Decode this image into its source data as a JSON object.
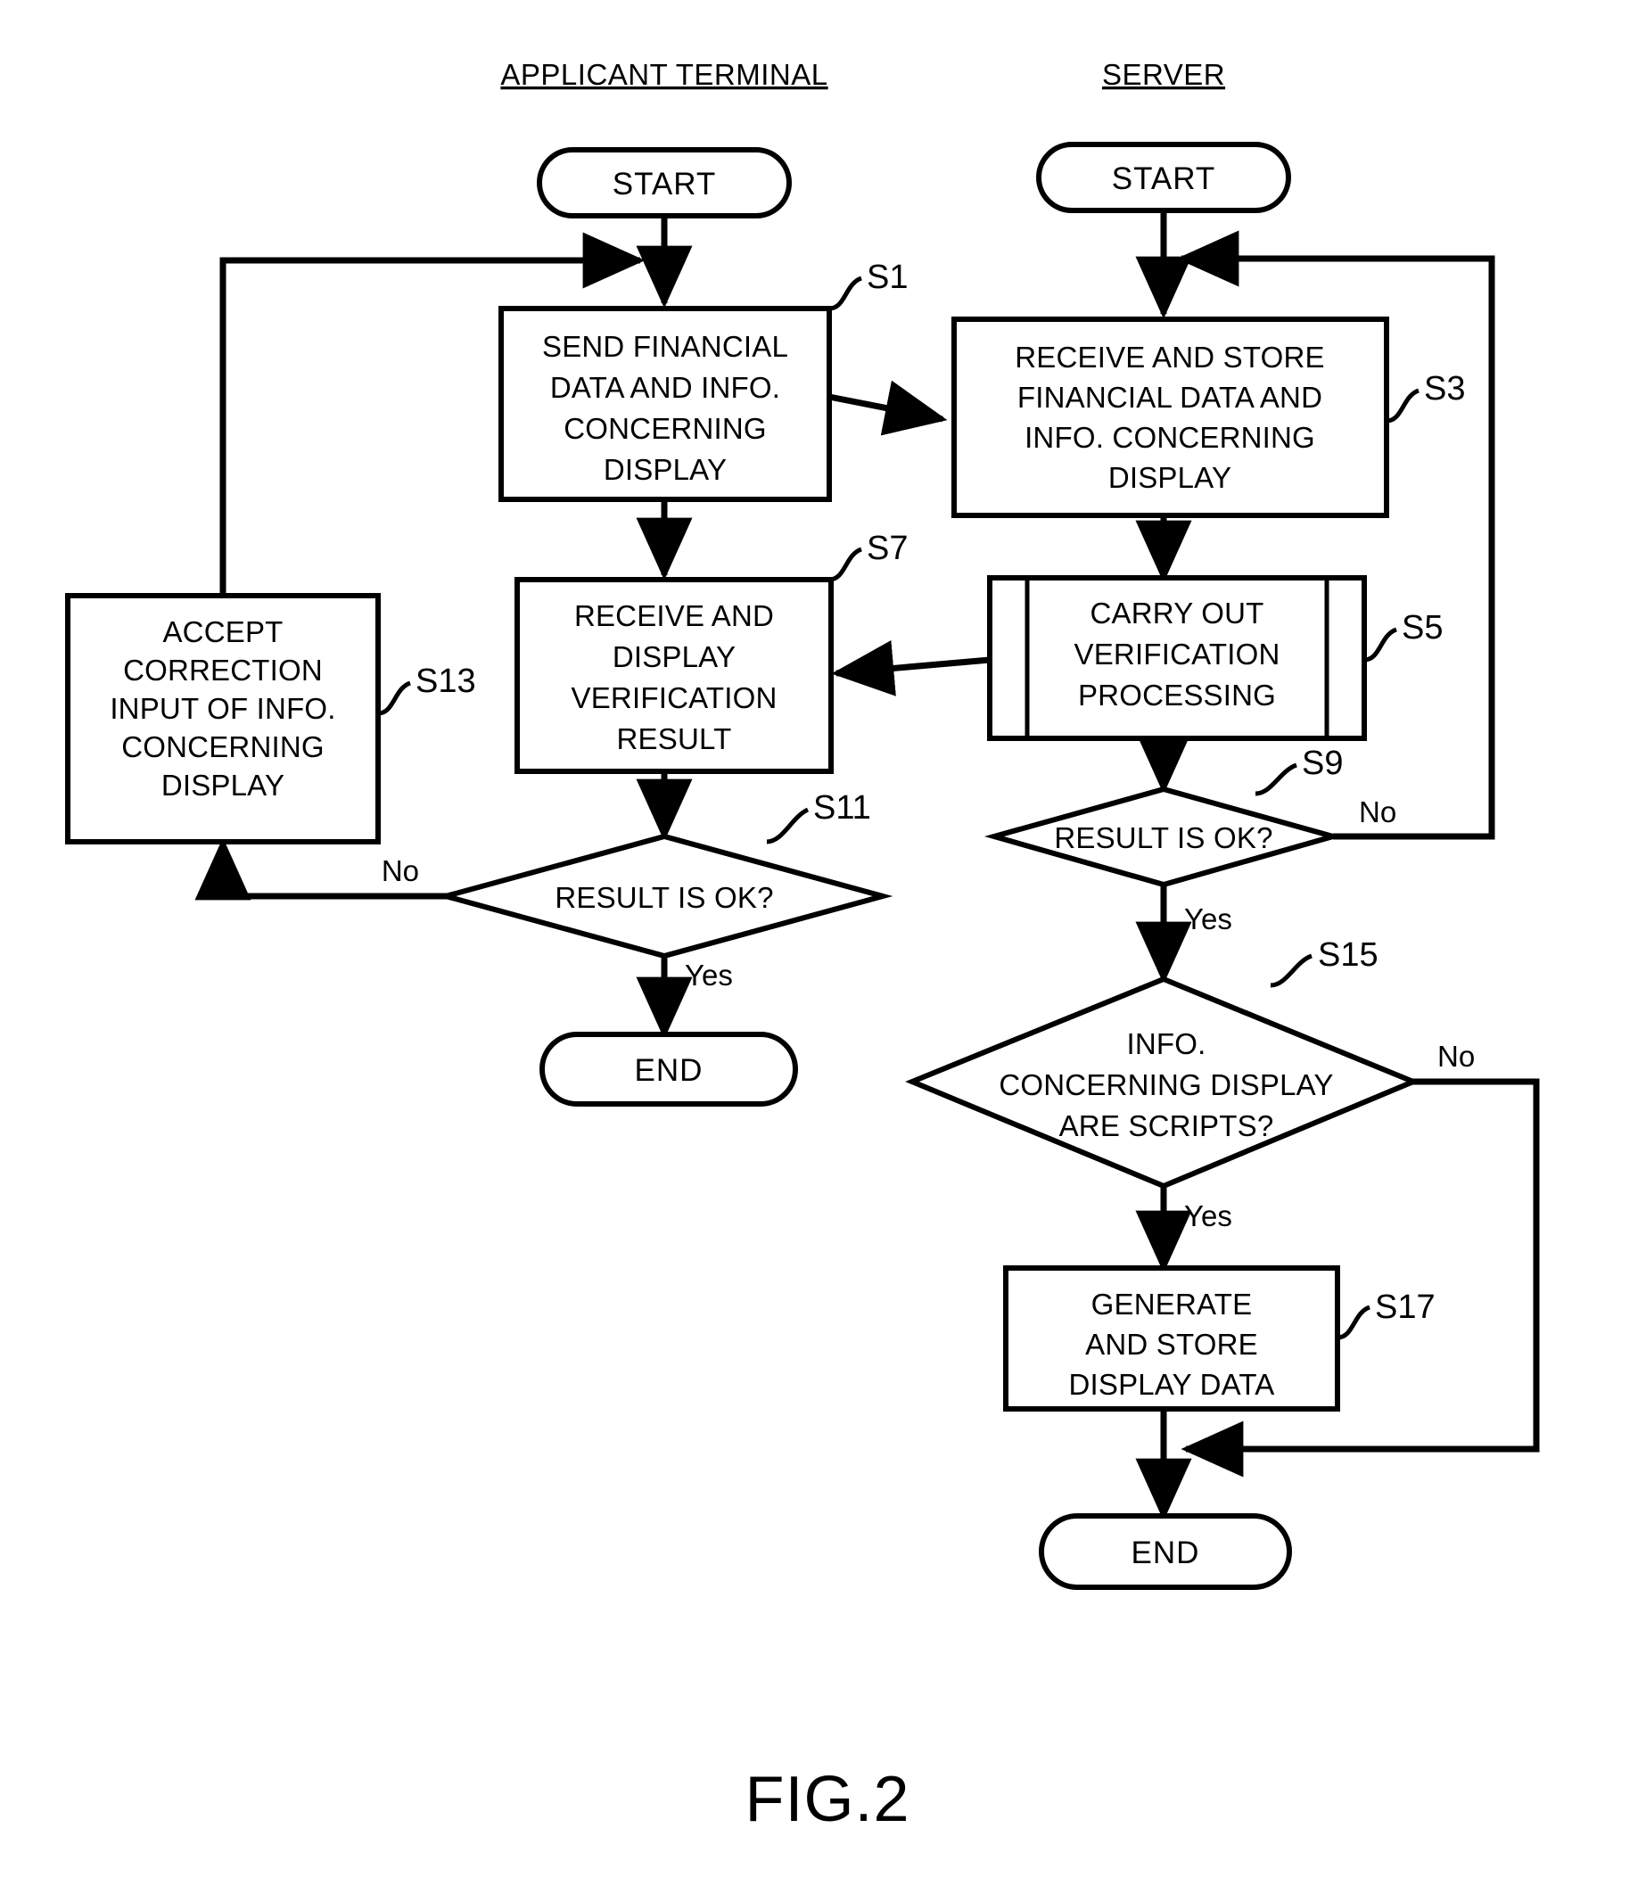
{
  "figure": {
    "caption": "FIG.2"
  },
  "lanes": [
    {
      "id": "applicant",
      "title": "APPLICANT TERMINAL"
    },
    {
      "id": "server",
      "title": "SERVER"
    }
  ],
  "chart_data": {
    "type": "diagram",
    "subtype": "flowchart",
    "title": "FIG.2",
    "swimlanes": [
      "APPLICANT TERMINAL",
      "SERVER"
    ],
    "nodes": [
      {
        "id": "start_a",
        "lane": "APPLICANT TERMINAL",
        "shape": "terminator",
        "label": "START",
        "step": ""
      },
      {
        "id": "s1",
        "lane": "APPLICANT TERMINAL",
        "shape": "process",
        "label": "SEND FINANCIAL DATA AND INFO. CONCERNING DISPLAY",
        "step": "S1"
      },
      {
        "id": "s7",
        "lane": "APPLICANT TERMINAL",
        "shape": "process",
        "label": "RECEIVE AND DISPLAY VERIFICATION RESULT",
        "step": "S7"
      },
      {
        "id": "s11",
        "lane": "APPLICANT TERMINAL",
        "shape": "decision",
        "label": "RESULT IS OK?",
        "step": "S11"
      },
      {
        "id": "s13",
        "lane": "APPLICANT TERMINAL",
        "shape": "process",
        "label": "ACCEPT CORRECTION INPUT OF INFO. CONCERNING DISPLAY",
        "step": "S13"
      },
      {
        "id": "end_a",
        "lane": "APPLICANT TERMINAL",
        "shape": "terminator",
        "label": "END",
        "step": ""
      },
      {
        "id": "start_b",
        "lane": "SERVER",
        "shape": "terminator",
        "label": "START",
        "step": ""
      },
      {
        "id": "s3",
        "lane": "SERVER",
        "shape": "process",
        "label": "RECEIVE AND STORE FINANCIAL DATA AND INFO. CONCERNING DISPLAY",
        "step": "S3"
      },
      {
        "id": "s5",
        "lane": "SERVER",
        "shape": "predefined-process",
        "label": "CARRY OUT VERIFICATION PROCESSING",
        "step": "S5"
      },
      {
        "id": "s9",
        "lane": "SERVER",
        "shape": "decision",
        "label": "RESULT IS OK?",
        "step": "S9"
      },
      {
        "id": "s15",
        "lane": "SERVER",
        "shape": "decision",
        "label": "INFO. CONCERNING DISPLAY ARE SCRIPTS?",
        "step": "S15"
      },
      {
        "id": "s17",
        "lane": "SERVER",
        "shape": "process",
        "label": "GENERATE AND STORE DISPLAY DATA",
        "step": "S17"
      },
      {
        "id": "end_b",
        "lane": "SERVER",
        "shape": "terminator",
        "label": "END",
        "step": ""
      }
    ],
    "edges": [
      {
        "from": "start_a",
        "to": "s1",
        "label": ""
      },
      {
        "from": "s1",
        "to": "s3",
        "label": ""
      },
      {
        "from": "s1",
        "to": "s7",
        "label": ""
      },
      {
        "from": "s5",
        "to": "s7",
        "label": ""
      },
      {
        "from": "s7",
        "to": "s11",
        "label": ""
      },
      {
        "from": "s11",
        "to": "end_a",
        "label": "Yes"
      },
      {
        "from": "s11",
        "to": "s13",
        "label": "No"
      },
      {
        "from": "s13",
        "to": "s1",
        "label": ""
      },
      {
        "from": "start_b",
        "to": "s3",
        "label": ""
      },
      {
        "from": "s3",
        "to": "s5",
        "label": ""
      },
      {
        "from": "s5",
        "to": "s9",
        "label": ""
      },
      {
        "from": "s9",
        "to": "s3",
        "label": "No"
      },
      {
        "from": "s9",
        "to": "s15",
        "label": "Yes"
      },
      {
        "from": "s15",
        "to": "s17",
        "label": "Yes"
      },
      {
        "from": "s15",
        "to": "end_b",
        "label": "No"
      },
      {
        "from": "s17",
        "to": "end_b",
        "label": ""
      }
    ]
  },
  "nodes": {
    "start_a": {
      "label": "START"
    },
    "s1": {
      "step": "S1",
      "lines": [
        "SEND FINANCIAL",
        "DATA AND INFO.",
        "CONCERNING",
        "DISPLAY"
      ]
    },
    "s7": {
      "step": "S7",
      "lines": [
        "RECEIVE AND",
        "DISPLAY",
        "VERIFICATION",
        "RESULT"
      ]
    },
    "s11": {
      "step": "S11",
      "lines": [
        "RESULT IS OK?"
      ],
      "yes": "Yes",
      "no": "No"
    },
    "s13": {
      "step": "S13",
      "lines": [
        "ACCEPT",
        "CORRECTION",
        "INPUT OF INFO.",
        "CONCERNING",
        "DISPLAY"
      ]
    },
    "end_a": {
      "label": "END"
    },
    "start_b": {
      "label": "START"
    },
    "s3": {
      "step": "S3",
      "lines": [
        "RECEIVE AND STORE",
        "FINANCIAL DATA AND",
        "INFO. CONCERNING",
        "DISPLAY"
      ]
    },
    "s5": {
      "step": "S5",
      "lines": [
        "CARRY OUT",
        "VERIFICATION",
        "PROCESSING"
      ]
    },
    "s9": {
      "step": "S9",
      "lines": [
        "RESULT IS OK?"
      ],
      "yes": "Yes",
      "no": "No"
    },
    "s15": {
      "step": "S15",
      "lines": [
        "INFO.",
        "CONCERNING DISPLAY",
        "ARE SCRIPTS?"
      ],
      "yes": "Yes",
      "no": "No"
    },
    "s17": {
      "step": "S17",
      "lines": [
        "GENERATE",
        "AND STORE",
        "DISPLAY DATA"
      ]
    },
    "end_b": {
      "label": "END"
    }
  },
  "colors": {
    "stroke": "#000000",
    "fill": "#ffffff",
    "background": "#ffffff"
  }
}
